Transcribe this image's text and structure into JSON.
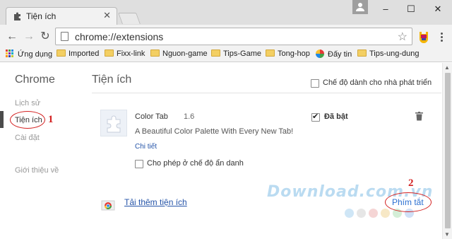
{
  "tab": {
    "title": "Tiện ích",
    "close": "✕"
  },
  "window": {
    "minimize": "–",
    "maximize": "☐",
    "close": "✕"
  },
  "toolbar": {
    "back": "←",
    "forward": "→",
    "reload": "↻",
    "url": "chrome://extensions",
    "star": "☆"
  },
  "bookmarks": [
    {
      "label": "Ứng dụng",
      "icon": "apps-icon"
    },
    {
      "label": "Imported",
      "icon": "folder-icon"
    },
    {
      "label": "Fixx-link",
      "icon": "folder-icon"
    },
    {
      "label": "Nguon-game",
      "icon": "folder-icon"
    },
    {
      "label": "Tips-Game",
      "icon": "folder-icon"
    },
    {
      "label": "Tong-hop",
      "icon": "folder-icon"
    },
    {
      "label": "Đấy tin",
      "icon": "site-favicon"
    },
    {
      "label": "Tips-ung-dung",
      "icon": "folder-icon"
    }
  ],
  "sidebar": {
    "brand": "Chrome",
    "items": [
      {
        "label": "Lịch sử"
      },
      {
        "label": "Tiện ích"
      },
      {
        "label": "Cài đặt"
      },
      {
        "label": "Giới thiệu về"
      }
    ]
  },
  "annotations": {
    "step1": "1",
    "step2": "2"
  },
  "main": {
    "title": "Tiện ích",
    "dev_mode_label": "Chế độ dành cho nhà phát triển",
    "extension": {
      "name": "Color Tab",
      "version": "1.6",
      "enabled_label": "Đã bật",
      "description": "A Beautiful Color Palette With Every New Tab!",
      "details_link": "Chi tiết",
      "incognito_label": "Cho phép ở chế độ ẩn danh"
    },
    "more_extensions_link": "Tải thêm tiện ích",
    "shortcuts_link": "Phím tắt"
  },
  "watermark": "Download.com.vn",
  "colors": {
    "accent_red": "#d32020",
    "link_blue": "#2554a8",
    "shortcut_blue": "#2a6fd1"
  }
}
